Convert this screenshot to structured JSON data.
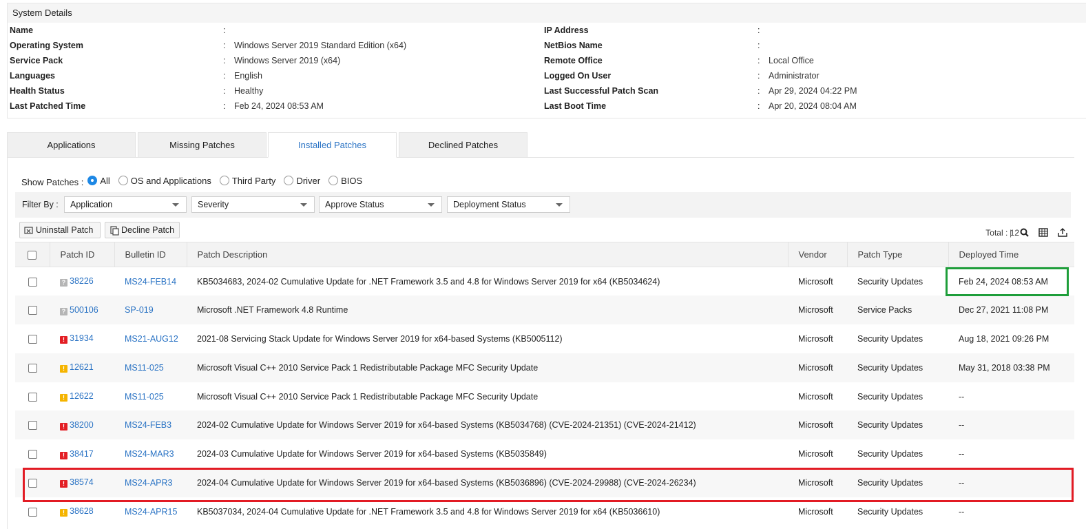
{
  "system_details": {
    "title": "System Details",
    "left": [
      {
        "label": "Name",
        "value": ""
      },
      {
        "label": "Operating System",
        "value": "Windows Server 2019 Standard Edition (x64)"
      },
      {
        "label": "Service Pack",
        "value": "Windows Server 2019 (x64)"
      },
      {
        "label": "Languages",
        "value": "English"
      },
      {
        "label": "Health Status",
        "value": "Healthy"
      },
      {
        "label": "Last Patched Time",
        "value": "Feb 24, 2024 08:53 AM"
      }
    ],
    "right": [
      {
        "label": "IP Address",
        "value": ""
      },
      {
        "label": "NetBios Name",
        "value": ""
      },
      {
        "label": "Remote Office",
        "value": "Local Office"
      },
      {
        "label": "Logged On User",
        "value": "Administrator"
      },
      {
        "label": "Last Successful Patch Scan",
        "value": "Apr 29, 2024 04:22 PM"
      },
      {
        "label": "Last Boot Time",
        "value": "Apr 20, 2024 08:04 AM"
      }
    ],
    "colon": ":"
  },
  "tabs": [
    {
      "label": "Applications",
      "active": false
    },
    {
      "label": "Missing Patches",
      "active": false
    },
    {
      "label": "Installed Patches",
      "active": true
    },
    {
      "label": "Declined Patches",
      "active": false
    }
  ],
  "show_patches": {
    "label": "Show Patches :",
    "options": [
      "All",
      "OS and Applications",
      "Third Party",
      "Driver",
      "BIOS"
    ],
    "selected": "All"
  },
  "filter": {
    "label": "Filter By :",
    "selects": [
      "Application",
      "Severity",
      "Approve Status",
      "Deployment Status"
    ]
  },
  "actions": {
    "uninstall": "Uninstall Patch",
    "decline": "Decline Patch",
    "total": "Total : 12",
    "separator": "|"
  },
  "table": {
    "columns": [
      "Patch ID",
      "Bulletin ID",
      "Patch Description",
      "Vendor",
      "Patch Type",
      "Deployed Time"
    ],
    "rows": [
      {
        "severity": "unknown",
        "patch_id": "38226",
        "bulletin": "MS24-FEB14",
        "description": "KB5034683, 2024-02 Cumulative Update for .NET Framework 3.5 and 4.8 for Windows Server 2019 for x64 (KB5034624)",
        "vendor": "Microsoft",
        "type": "Security Updates",
        "deployed": "Feb 24, 2024 08:53 AM"
      },
      {
        "severity": "unknown",
        "patch_id": "500106",
        "bulletin": "SP-019",
        "description": "Microsoft .NET Framework 4.8 Runtime",
        "vendor": "Microsoft",
        "type": "Service Packs",
        "deployed": "Dec 27, 2021 11:08 PM"
      },
      {
        "severity": "critical",
        "patch_id": "31934",
        "bulletin": "MS21-AUG12",
        "description": "2021-08 Servicing Stack Update for Windows Server 2019 for x64-based Systems (KB5005112)",
        "vendor": "Microsoft",
        "type": "Security Updates",
        "deployed": "Aug 18, 2021 09:26 PM"
      },
      {
        "severity": "important",
        "patch_id": "12621",
        "bulletin": "MS11-025",
        "description": "Microsoft Visual C++ 2010 Service Pack 1 Redistributable Package MFC Security Update",
        "vendor": "Microsoft",
        "type": "Security Updates",
        "deployed": "May 31, 2018 03:38 PM"
      },
      {
        "severity": "important",
        "patch_id": "12622",
        "bulletin": "MS11-025",
        "description": "Microsoft Visual C++ 2010 Service Pack 1 Redistributable Package MFC Security Update",
        "vendor": "Microsoft",
        "type": "Security Updates",
        "deployed": "--"
      },
      {
        "severity": "critical",
        "patch_id": "38200",
        "bulletin": "MS24-FEB3",
        "description": "2024-02 Cumulative Update for Windows Server 2019 for x64-based Systems (KB5034768) (CVE-2024-21351) (CVE-2024-21412)",
        "vendor": "Microsoft",
        "type": "Security Updates",
        "deployed": "--"
      },
      {
        "severity": "critical",
        "patch_id": "38417",
        "bulletin": "MS24-MAR3",
        "description": "2024-03 Cumulative Update for Windows Server 2019 for x64-based Systems (KB5035849)",
        "vendor": "Microsoft",
        "type": "Security Updates",
        "deployed": "--"
      },
      {
        "severity": "critical",
        "patch_id": "38574",
        "bulletin": "MS24-APR3",
        "description": "2024-04 Cumulative Update for Windows Server 2019 for x64-based Systems (KB5036896) (CVE-2024-29988) (CVE-2024-26234)",
        "vendor": "Microsoft",
        "type": "Security Updates",
        "deployed": "--"
      },
      {
        "severity": "important",
        "patch_id": "38628",
        "bulletin": "MS24-APR15",
        "description": "KB5037034, 2024-04 Cumulative Update for .NET Framework 3.5 and 4.8 for Windows Server 2019 for x64 (KB5036610)",
        "vendor": "Microsoft",
        "type": "Security Updates",
        "deployed": "--"
      }
    ]
  },
  "colors": {
    "link": "#2a73c4",
    "critical": "#e31e24",
    "important": "#f5b400",
    "highlight_green": "#1e9e3a",
    "highlight_red": "#e21b24"
  }
}
